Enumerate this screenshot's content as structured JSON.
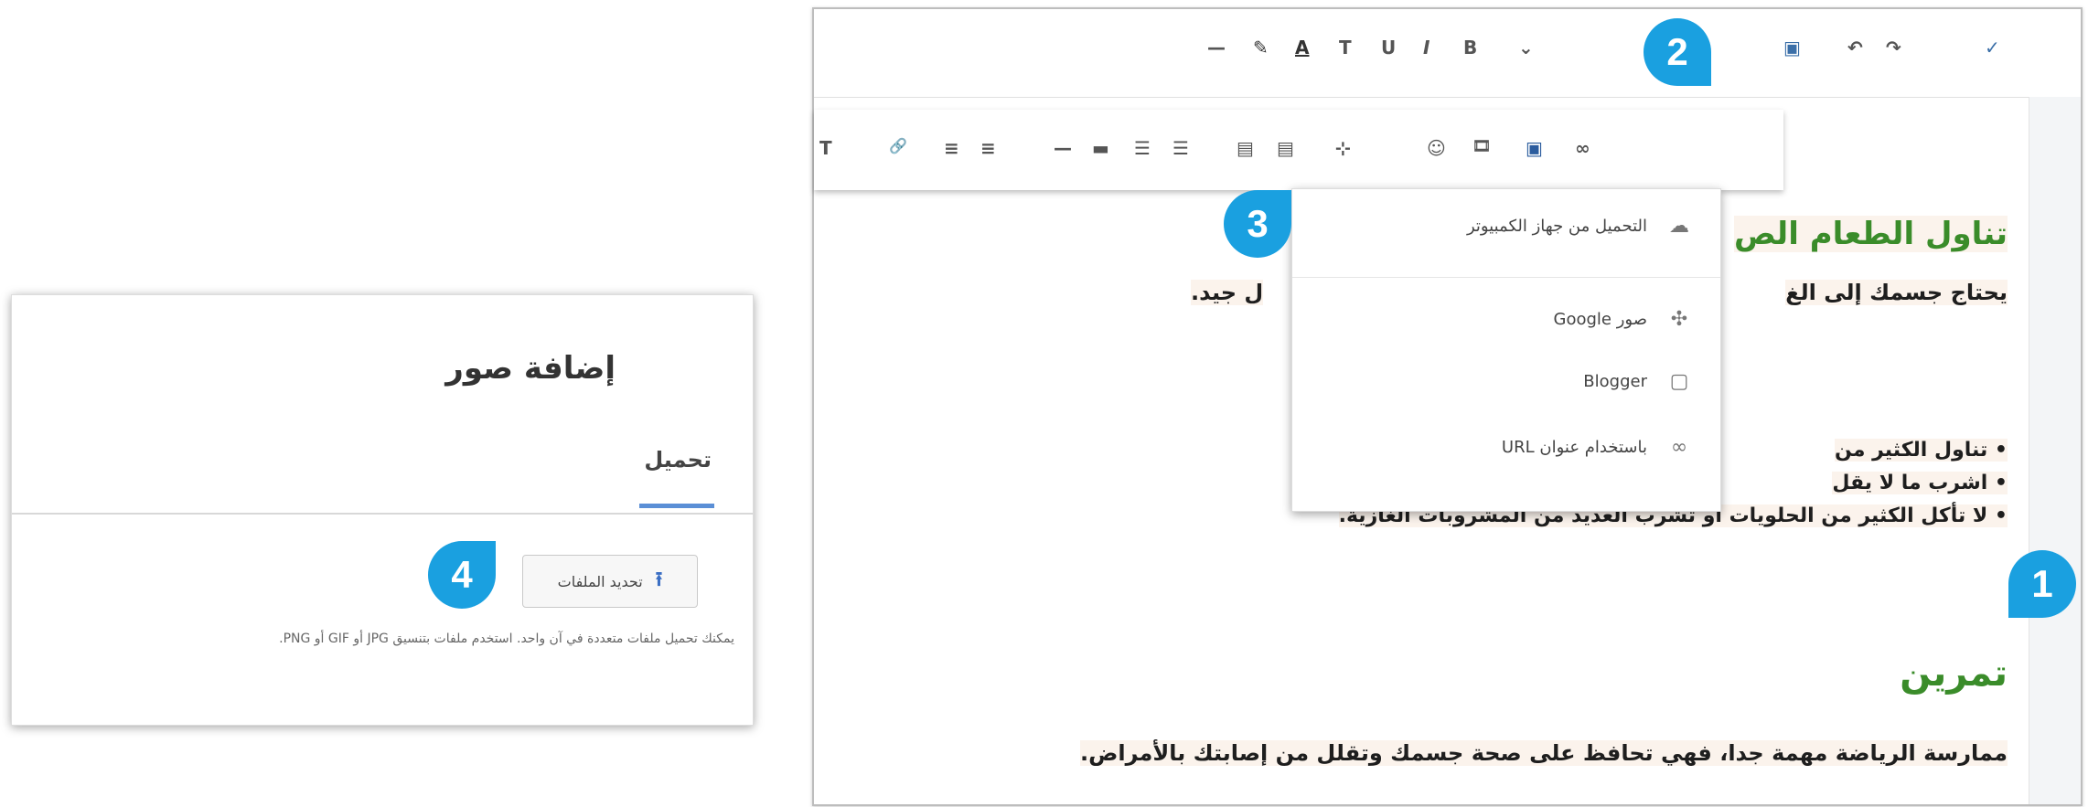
{
  "upload_dialog": {
    "title": "إضافة صور",
    "tab_upload": "تحميل",
    "choose_files_label": "تحديد الملفات",
    "hint_text": "يمكنك تحميل ملفات متعددة في آن واحد. استخدم ملفات بتنسيق JPG أو GIF أو PNG."
  },
  "editor": {
    "toolbar_row1": [
      "—",
      "✎",
      "A",
      "T",
      "U",
      "I",
      "B",
      "⌄",
      "▣",
      "↶",
      "↷",
      "✓"
    ],
    "toolbar_row2": [
      "T",
      "🔗",
      "≡",
      "≡",
      "—",
      "▬",
      "☰",
      "☰",
      "▤",
      "▤",
      "⊹",
      "☺",
      "🎞",
      "▣",
      "∞"
    ],
    "heading_1": "تناول الطعام الص",
    "paragraph_1_right": "يحتاج جسمك إلى الغ",
    "paragraph_1_left": "ل جيد.",
    "bullets": [
      "تناول الكثير من",
      "اشرب ما لا يقل",
      "لا تأكل الكثير من الحلويات أو تشرب العديد من المشروبات الغازية."
    ],
    "heading_2": "تمرين",
    "paragraph_2": "ممارسة الرياضة مهمة جدا، فهي تحافظ على صحة جسمك وتقلل من إصابتك بالأمراض."
  },
  "image_menu": {
    "items": [
      {
        "label": "التحميل من جهاز الكمبيوتر",
        "icon": "cloud-upload-icon"
      },
      {
        "label": "صور Google",
        "icon": "photos-pinwheel-icon"
      },
      {
        "label": "Blogger",
        "icon": "blogger-square-icon"
      },
      {
        "label": "باستخدام عنوان URL",
        "icon": "link-icon"
      }
    ]
  },
  "callouts": [
    "1",
    "2",
    "3",
    "4"
  ],
  "colors": {
    "callout": "#1aa0e0",
    "heading_green": "#3a8c2a",
    "tab_underline": "#5b8fd6"
  }
}
